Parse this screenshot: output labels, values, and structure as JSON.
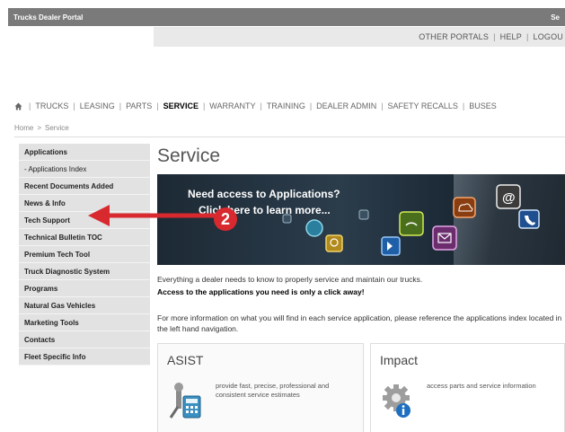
{
  "topbar": {
    "title": "Trucks Dealer Portal",
    "right": "Se"
  },
  "util_links": [
    "OTHER PORTALS",
    "HELP",
    "LOGOU"
  ],
  "main_nav": [
    "TRUCKS",
    "LEASING",
    "PARTS",
    "SERVICE",
    "WARRANTY",
    "TRAINING",
    "DEALER ADMIN",
    "SAFETY RECALLS",
    "BUSES"
  ],
  "main_nav_active": "SERVICE",
  "breadcrumb": {
    "home": "Home",
    "sep": ">",
    "current": "Service"
  },
  "sidebar": {
    "items": [
      "Applications",
      "- Applications Index",
      "Recent Documents Added",
      "News & Info",
      "Tech Support",
      "Technical Bulletin TOC",
      "Premium Tech Tool",
      "Truck Diagnostic System",
      "Programs",
      "Natural Gas Vehicles",
      "Marketing Tools",
      "Contacts",
      "Fleet Specific Info"
    ]
  },
  "page": {
    "title": "Service",
    "banner_heading": "Need access to Applications?",
    "banner_sub": "Click here to learn more...",
    "desc_line1": "Everything a dealer needs to know to properly service and maintain our trucks.",
    "desc_line2": "Access to the applications you need is only a click away!",
    "desc_line3": "For more information on what you will find in each service application, please reference the applications index located in the left hand navigation."
  },
  "callout": {
    "number": "2",
    "color": "#d8292f"
  },
  "cards": [
    {
      "title": "ASIST",
      "text": "provide fast, precise, professional and consistent service estimates",
      "icon": "calculator-tools-icon"
    },
    {
      "title": "Impact",
      "text": "access parts and service information",
      "icon": "gear-info-icon"
    }
  ],
  "colors": {
    "topbar": "#7a7a7a",
    "sidebar": "#e2e2e2",
    "arrow": "#d8292f",
    "banner": "#23323f"
  }
}
